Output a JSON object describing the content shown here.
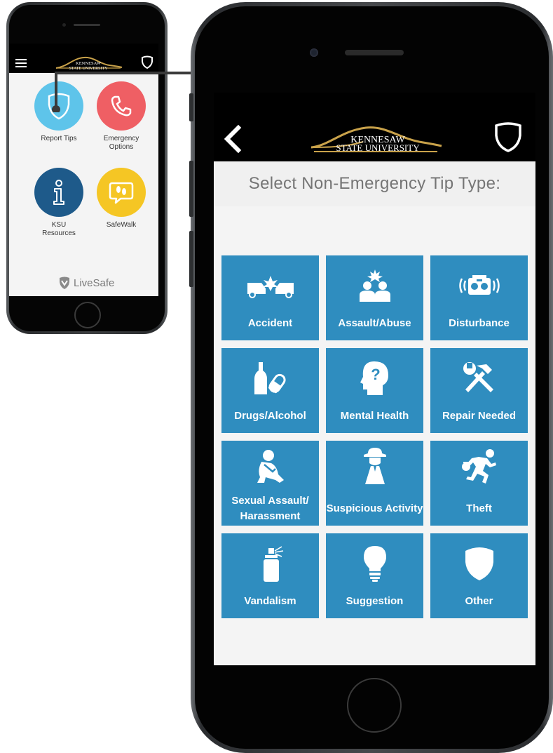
{
  "small_phone": {
    "header": {
      "logo_line1": "KENNESAW",
      "logo_line2": "STATE UNIVERSITY"
    },
    "tiles": [
      {
        "label": "Report Tips",
        "color": "#5ec4ea",
        "icon": "shield-icon"
      },
      {
        "label": "Emergency Options",
        "color": "#ef5f64",
        "icon": "phone-icon"
      },
      {
        "label": "KSU Resources",
        "color": "#1e5a8a",
        "icon": "info-icon"
      },
      {
        "label": "SafeWalk",
        "color": "#f5c624",
        "icon": "footsteps-chat-icon"
      }
    ],
    "footer_brand": "LiveSafe"
  },
  "big_phone": {
    "header": {
      "logo_line1": "KENNESAW",
      "logo_line2": "STATE UNIVERSITY"
    },
    "title": "Select Non-Emergency Tip Type:",
    "tile_color": "#2f8dbf",
    "tip_types": [
      {
        "label": "Accident",
        "icon": "car-crash-icon"
      },
      {
        "label": "Assault/Abuse",
        "icon": "assault-icon"
      },
      {
        "label": "Disturbance",
        "icon": "boombox-icon"
      },
      {
        "label": "Drugs/Alcohol",
        "icon": "bottle-pill-icon"
      },
      {
        "label": "Mental Health",
        "icon": "head-question-icon"
      },
      {
        "label": "Repair Needed",
        "icon": "tools-icon"
      },
      {
        "label": "Sexual Assault/ Harassment",
        "icon": "crouching-person-icon"
      },
      {
        "label": "Suspicious Activity",
        "icon": "hat-person-icon"
      },
      {
        "label": "Theft",
        "icon": "running-thief-icon"
      },
      {
        "label": "Vandalism",
        "icon": "spray-can-icon"
      },
      {
        "label": "Suggestion",
        "icon": "lightbulb-icon"
      },
      {
        "label": "Other",
        "icon": "shield-icon"
      }
    ]
  }
}
